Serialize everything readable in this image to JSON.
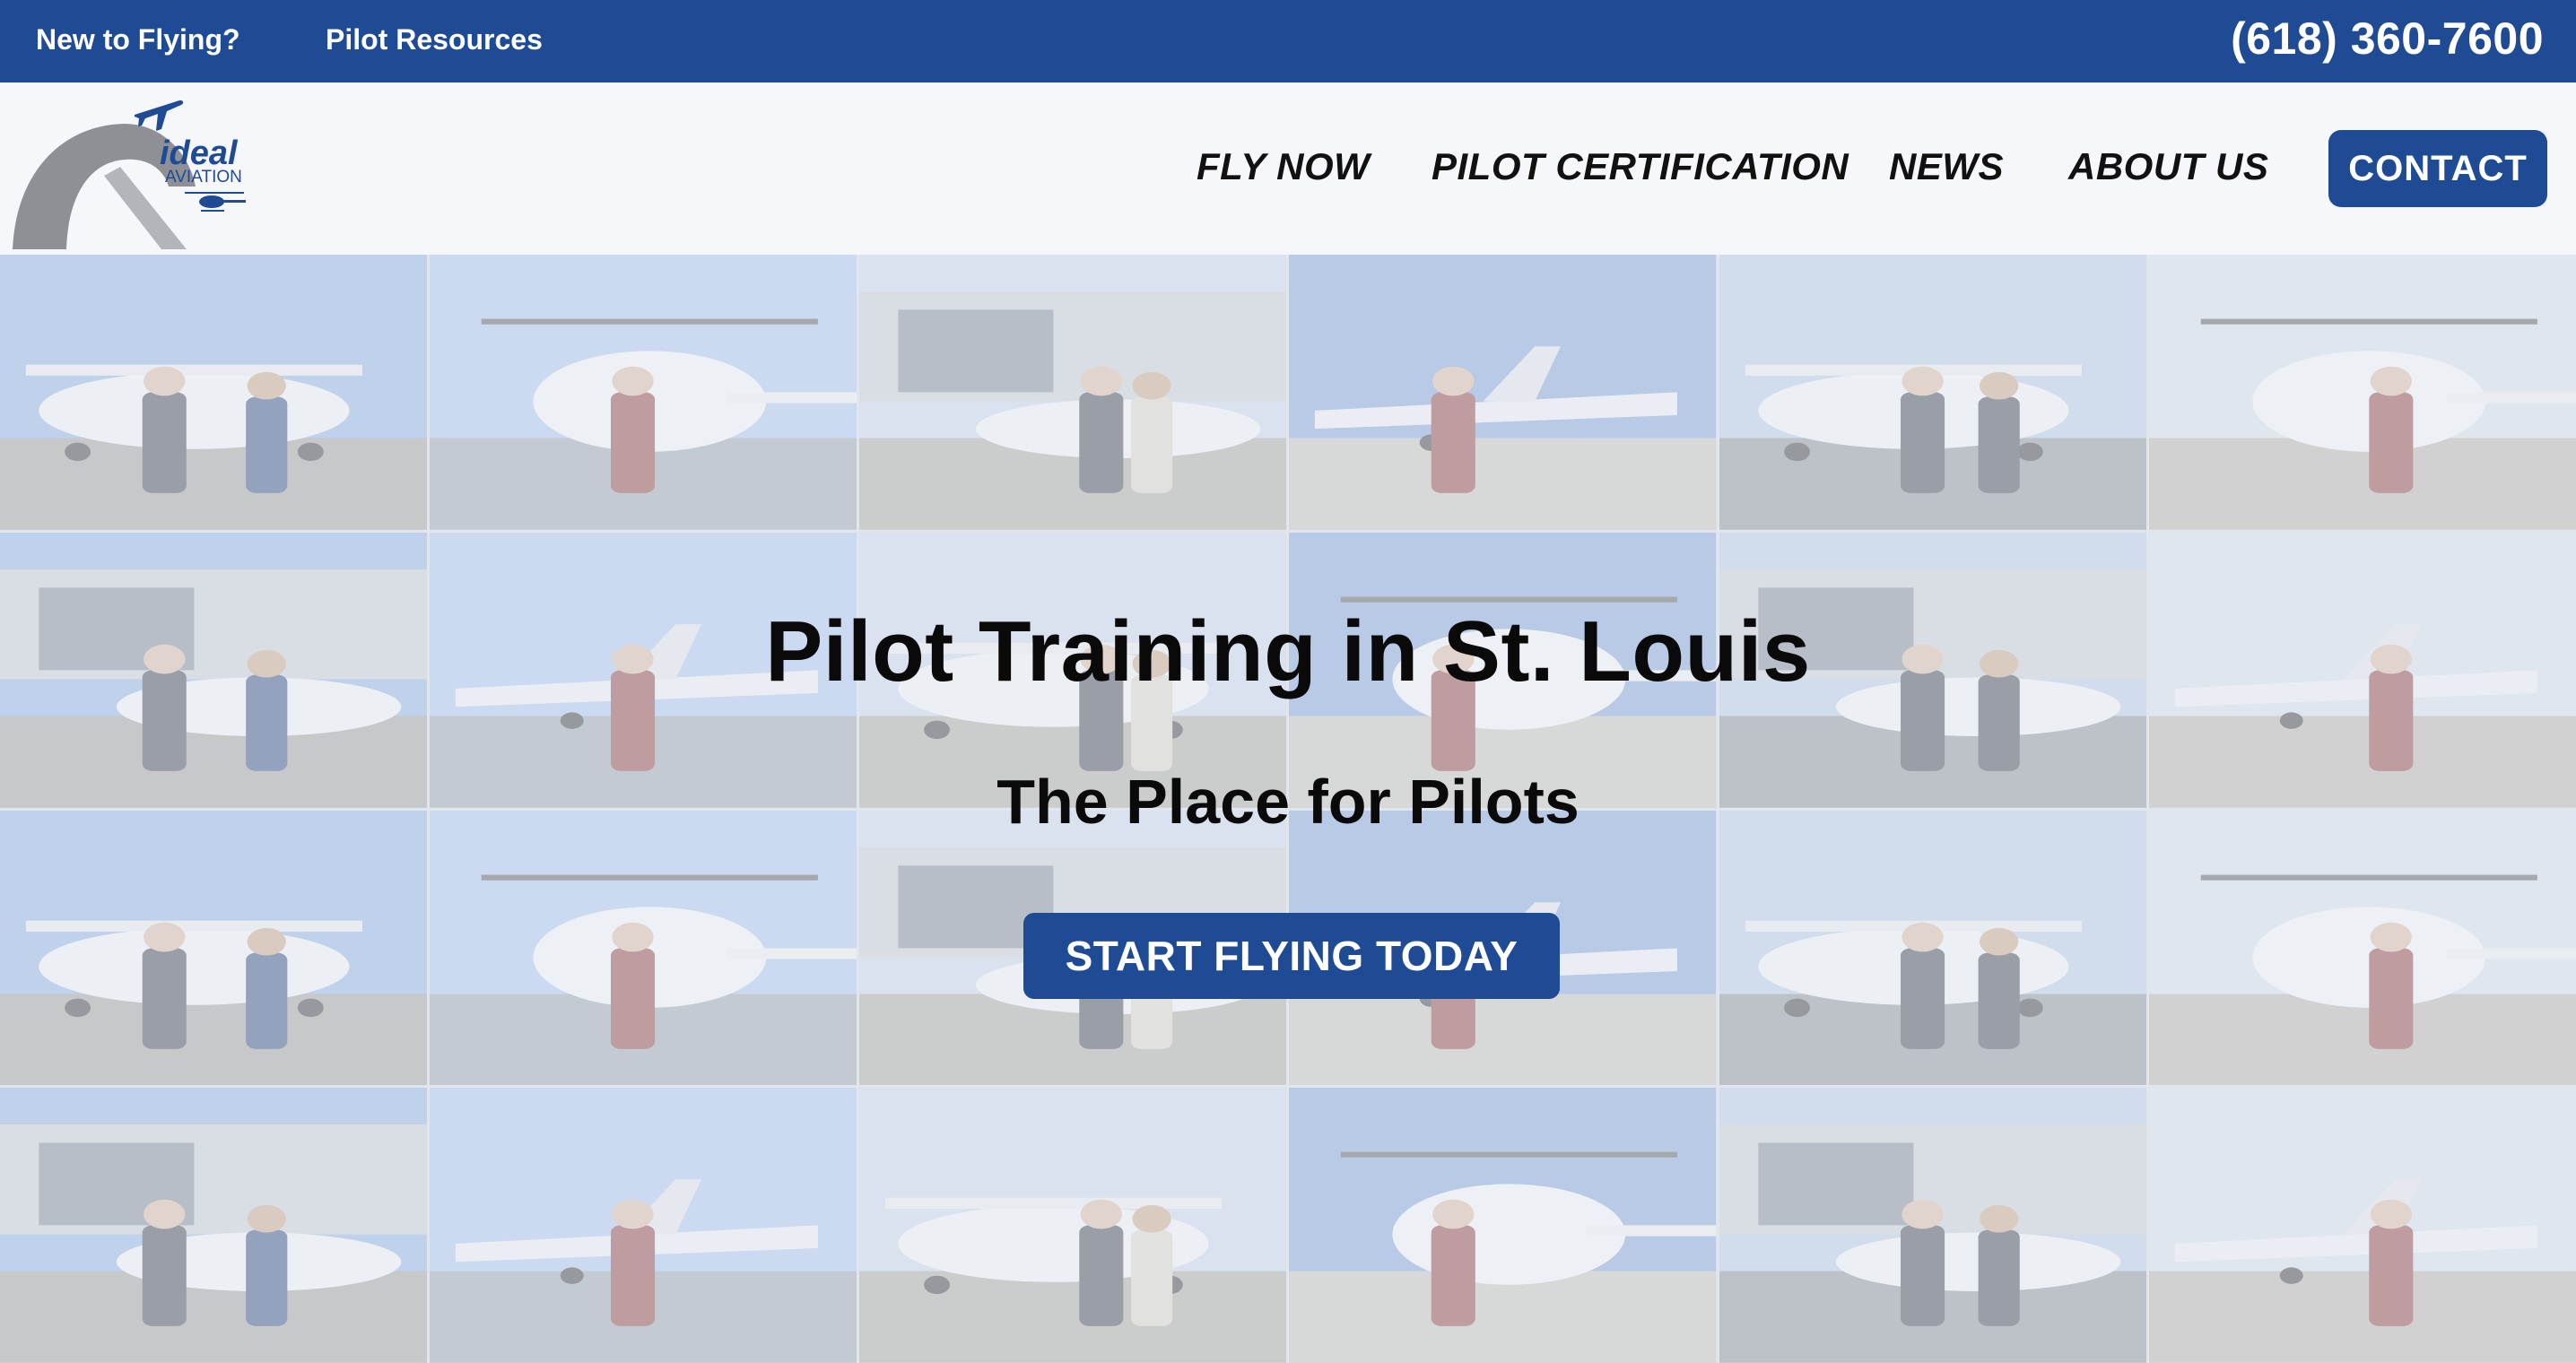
{
  "topbar": {
    "links": [
      "New to Flying?",
      "Pilot Resources"
    ],
    "phone": "(618) 360-7600"
  },
  "logo": {
    "brand_line1": "ideal",
    "brand_line2": "AVIATION"
  },
  "nav": {
    "items": [
      "FLY NOW",
      "PILOT CERTIFICATION",
      "NEWS",
      "ABOUT US"
    ],
    "contact_label": "CONTACT"
  },
  "hero": {
    "title": "Pilot Training in St. Louis",
    "subtitle": "The Place for Pilots",
    "cta_label": "START FLYING TODAY",
    "photo_count": 24
  },
  "colors": {
    "brand_blue": "#1f4a94",
    "page_bg": "#f5f7fa",
    "text": "#0a0a0a"
  },
  "icons": [
    "airplane-icon",
    "helicopter-icon",
    "runway-arc-icon"
  ]
}
